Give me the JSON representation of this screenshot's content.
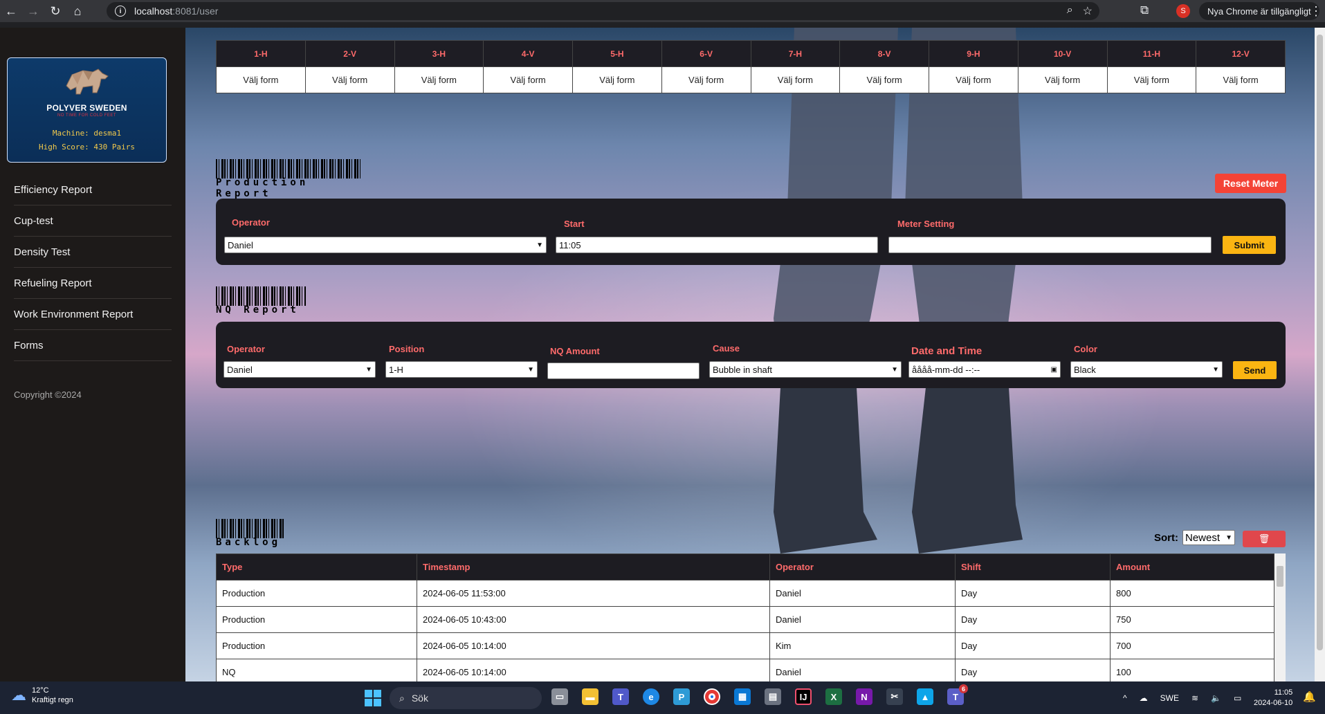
{
  "browser": {
    "url_host": "localhost",
    "url_rest": ":8081/user",
    "update_label": "Nya Chrome är tillgängligt",
    "profile_initial": "S"
  },
  "sidebar": {
    "brand_name": "POLYVER SWEDEN",
    "tagline": "NO TIME FOR COLD FEET",
    "machine": "Machine: desma1",
    "high_score": "High Score: 430 Pairs",
    "nav": [
      {
        "label": "Efficiency Report"
      },
      {
        "label": "Cup-test"
      },
      {
        "label": "Density Test"
      },
      {
        "label": "Refueling Report"
      },
      {
        "label": "Work Environment Report"
      },
      {
        "label": "Forms"
      }
    ],
    "copyright": "Copyright ©2024"
  },
  "form_table": {
    "headers": [
      "1-H",
      "2-V",
      "3-H",
      "4-V",
      "5-H",
      "6-V",
      "7-H",
      "8-V",
      "9-H",
      "10-V",
      "11-H",
      "12-V"
    ],
    "cell_label": "Välj form"
  },
  "production": {
    "title": "Production Report",
    "reset_label": "Reset Meter",
    "operator_label": "Operator",
    "operator_value": "Daniel",
    "start_label": "Start",
    "start_value": "11:05",
    "meter_label": "Meter Setting",
    "meter_value": "",
    "submit_label": "Submit"
  },
  "nq": {
    "title": "NQ Report",
    "operator_label": "Operator",
    "operator_value": "Daniel",
    "position_label": "Position",
    "position_value": "1-H",
    "amount_label": "NQ Amount",
    "amount_value": "",
    "cause_label": "Cause",
    "cause_value": "Bubble in shaft",
    "datetime_label": "Date and Time",
    "datetime_placeholder": "åååå-mm-dd --:--",
    "color_label": "Color",
    "color_value": "Black",
    "send_label": "Send"
  },
  "backlog": {
    "title": "Backlog",
    "sort_label": "Sort:",
    "sort_value": "Newest",
    "columns": [
      "Type",
      "Timestamp",
      "Operator",
      "Shift",
      "Amount"
    ],
    "rows": [
      [
        "Production",
        "2024-06-05 11:53:00",
        "Daniel",
        "Day",
        "800"
      ],
      [
        "Production",
        "2024-06-05 10:43:00",
        "Daniel",
        "Day",
        "750"
      ],
      [
        "Production",
        "2024-06-05 10:14:00",
        "Kim",
        "Day",
        "700"
      ],
      [
        "NQ",
        "2024-06-05 10:14:00",
        "Daniel",
        "Day",
        "100"
      ]
    ]
  },
  "taskbar": {
    "temperature": "12°C",
    "weather": "Kraftigt regn",
    "search_placeholder": "Sök",
    "language": "SWE",
    "time": "11:05",
    "date": "2024-06-10",
    "teams_badge": "6"
  },
  "colors": {
    "accent_red": "#ff6b6b",
    "button_yellow": "#fbb512",
    "reset_red": "#f44336",
    "panel_dark": "#1d1c22",
    "sidebar_dark": "#1d1a19"
  }
}
